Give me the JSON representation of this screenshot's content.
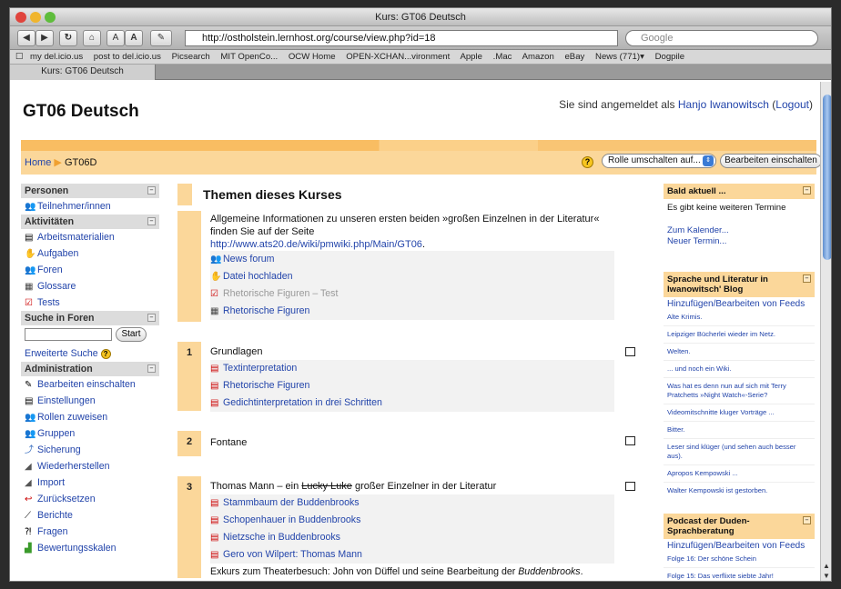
{
  "browser": {
    "window_title": "Kurs: GT06 Deutsch",
    "url": "http://ostholstein.lernhost.org/course/view.php?id=18",
    "search_placeholder": "Google",
    "bookmarks": [
      "my del.icio.us",
      "post to del.icio.us",
      "Picsearch",
      "MIT OpenCo...",
      "OCW Home",
      "OPEN-XCHAN...vironment",
      "Apple",
      ".Mac",
      "Amazon",
      "eBay",
      "News (771)▾",
      "Dogpile"
    ],
    "tab_title": "Kurs: GT06 Deutsch"
  },
  "header": {
    "site_name": "GT06 Deutsch",
    "login_prefix": "Sie sind angemeldet als ",
    "user_name": "Hanjo Iwanowitsch",
    "logout_open": " (",
    "logout_label": "Logout",
    "logout_close": ")"
  },
  "navbar": {
    "home": "Home",
    "arrow": "▶",
    "course": "GT06D",
    "role_switch": "Rolle umschalten auf...",
    "edit_on": "Bearbeiten einschalten"
  },
  "left": {
    "personen": {
      "title": "Personen",
      "items": [
        {
          "label": "Teilnehmer/innen",
          "icon": "users-icon"
        }
      ]
    },
    "aktivitaeten": {
      "title": "Aktivitäten",
      "items": [
        {
          "label": "Arbeitsmaterialien",
          "icon": "resource-icon"
        },
        {
          "label": "Aufgaben",
          "icon": "assignment-icon"
        },
        {
          "label": "Foren",
          "icon": "forum-icon"
        },
        {
          "label": "Glossare",
          "icon": "glossary-icon"
        },
        {
          "label": "Tests",
          "icon": "quiz-icon"
        }
      ]
    },
    "suche": {
      "title": "Suche in Foren",
      "button": "Start",
      "advanced": "Erweiterte Suche"
    },
    "administration": {
      "title": "Administration",
      "items": [
        {
          "label": "Bearbeiten einschalten",
          "icon": "edit-icon"
        },
        {
          "label": "Einstellungen",
          "icon": "settings-icon"
        },
        {
          "label": "Rollen zuweisen",
          "icon": "roles-icon"
        },
        {
          "label": "Gruppen",
          "icon": "groups-icon"
        },
        {
          "label": "Sicherung",
          "icon": "backup-icon"
        },
        {
          "label": "Wiederherstellen",
          "icon": "restore-icon"
        },
        {
          "label": "Import",
          "icon": "import-icon"
        },
        {
          "label": "Zurücksetzen",
          "icon": "reset-icon"
        },
        {
          "label": "Berichte",
          "icon": "reports-icon"
        },
        {
          "label": "Fragen",
          "icon": "questions-icon"
        },
        {
          "label": "Bewertungsskalen",
          "icon": "scales-icon"
        }
      ]
    }
  },
  "center": {
    "title": "Themen dieses Kurses",
    "section0": {
      "intro": "Allgemeine Informationen zu unseren ersten beiden »großen Einzelnen in der Literatur« finden Sie auf der Seite",
      "link": "http://www.ats20.de/wiki/pmwiki.php/Main/GT06",
      "link_suffix": ".",
      "items": [
        {
          "label": "News forum",
          "icon": "forum-icon",
          "dim": false
        },
        {
          "label": "Datei hochladen",
          "icon": "assignment-icon",
          "dim": false
        },
        {
          "label": "Rhetorische Figuren – Test",
          "icon": "quiz-icon",
          "dim": true
        },
        {
          "label": "Rhetorische Figuren",
          "icon": "glossary-icon",
          "dim": false
        }
      ]
    },
    "section1": {
      "num": "1",
      "title": "Grundlagen",
      "items": [
        "Textinterpretation",
        "Rhetorische Figuren",
        "Gedichtinterpretation in drei Schritten"
      ]
    },
    "section2": {
      "num": "2",
      "title": "Fontane"
    },
    "section3": {
      "num": "3",
      "title_a": "Thomas Mann – ein ",
      "title_strike": "Lucky Luke",
      "title_b": " großer Einzelner in der Literatur",
      "items": [
        "Stammbaum der Buddenbrooks",
        "Schopenhauer in Buddenbrooks",
        "Nietzsche in Buddenbrooks",
        "Gero von Wilpert: Thomas Mann"
      ],
      "note_a": "Exkurs zum Theaterbesuch: John von Düffel und seine Bearbeitung der ",
      "note_em": "Buddenbrooks",
      "note_b": "."
    }
  },
  "right": {
    "upcoming": {
      "title": "Bald aktuell ...",
      "empty": "Es gibt keine weiteren Termine",
      "calendar": "Zum Kalender...",
      "new_event": "Neuer Termin..."
    },
    "blog": {
      "title": "Sprache und Literatur in Iwanowitsch' Blog",
      "add": "Hinzufügen/Bearbeiten von Feeds",
      "items": [
        "Alte Krimis.",
        "Leipziger Bücherlei wieder im Netz.",
        "Welten.",
        "... und noch ein Wiki.",
        "Was hat es denn nun auf sich mit Terry Pratchetts »Night Watch«-Serie?",
        "Videomitschnitte kluger Vorträge ...",
        "Bitter.",
        "Leser sind klüger (und sehen auch besser aus).",
        "Apropos Kempowski ...",
        "Walter Kempowski ist gestorben."
      ]
    },
    "podcast": {
      "title": "Podcast der Duden-Sprachberatung",
      "add": "Hinzufügen/Bearbeiten von Feeds",
      "items": [
        "Folge 16: Der schöne Schein",
        "Folge 15: Das verflixte siebte Jahr!"
      ]
    }
  },
  "colors": {
    "accent": "#fbd79a",
    "link": "#2244aa",
    "block_head": "#dcdcdc"
  }
}
